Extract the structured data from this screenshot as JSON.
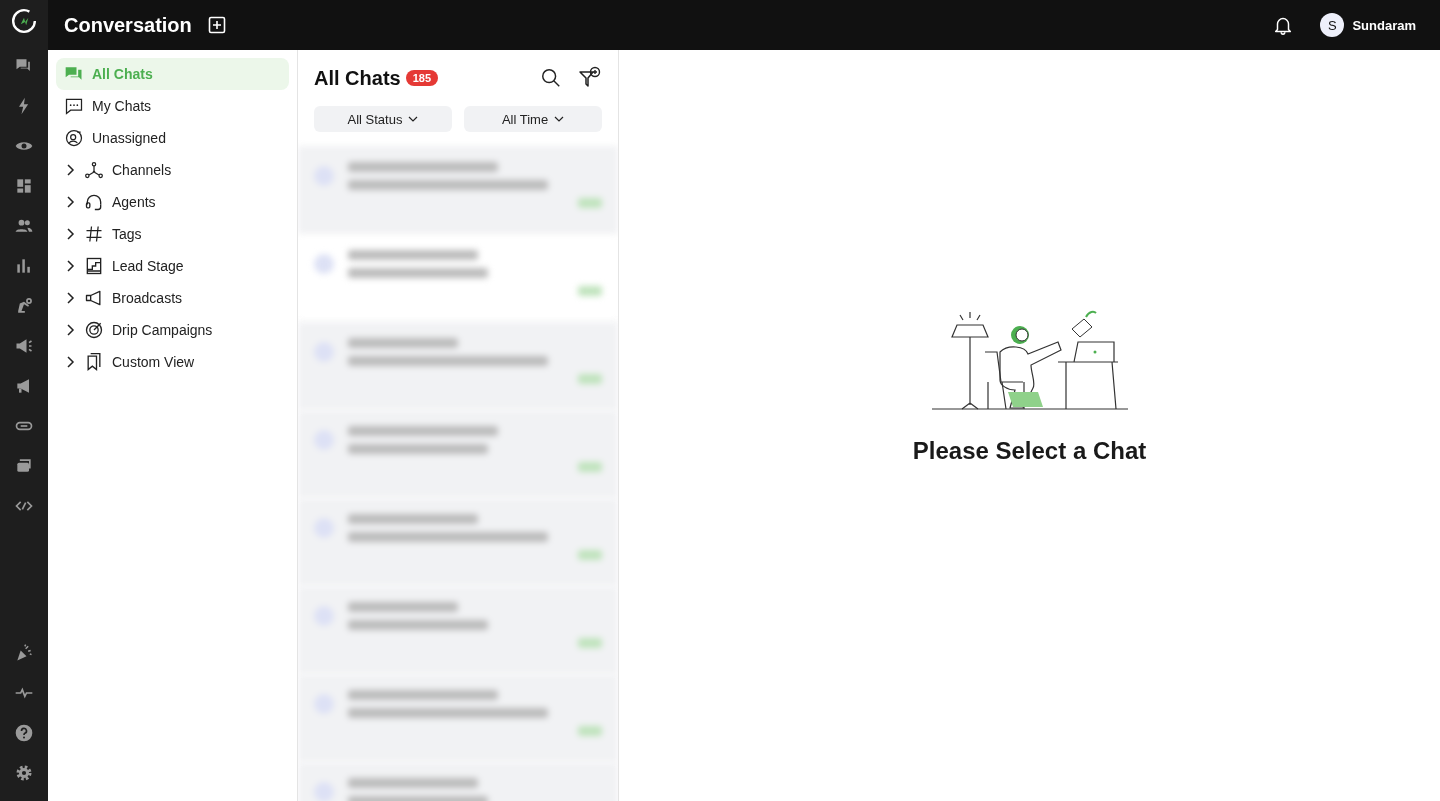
{
  "header": {
    "title": "Conversation",
    "user": {
      "initial": "S",
      "name": "Sundaram"
    }
  },
  "nav": [
    {
      "label": "All Chats",
      "selected": true
    },
    {
      "label": "My Chats",
      "selected": false
    },
    {
      "label": "Unassigned",
      "selected": false
    },
    {
      "label": "Channels",
      "selected": false,
      "expanded": false
    },
    {
      "label": "Agents",
      "selected": false,
      "expanded": false
    },
    {
      "label": "Tags",
      "selected": false,
      "expanded": false
    },
    {
      "label": "Lead Stage",
      "selected": false,
      "expanded": false
    },
    {
      "label": "Broadcasts",
      "selected": false,
      "expanded": false
    },
    {
      "label": "Drip Campaigns",
      "selected": false,
      "expanded": false
    },
    {
      "label": "Custom View",
      "selected": false,
      "expanded": false
    }
  ],
  "chat_list": {
    "title": "All Chats",
    "count": "185",
    "filters": [
      "All Status",
      "All Time"
    ],
    "rows": [
      {
        "shaded": true
      },
      {
        "shaded": false
      },
      {
        "shaded": true
      },
      {
        "shaded": true
      },
      {
        "shaded": true
      },
      {
        "shaded": true
      },
      {
        "shaded": true
      },
      {
        "shaded": true
      }
    ]
  },
  "empty_state": {
    "message": "Please Select a Chat"
  }
}
